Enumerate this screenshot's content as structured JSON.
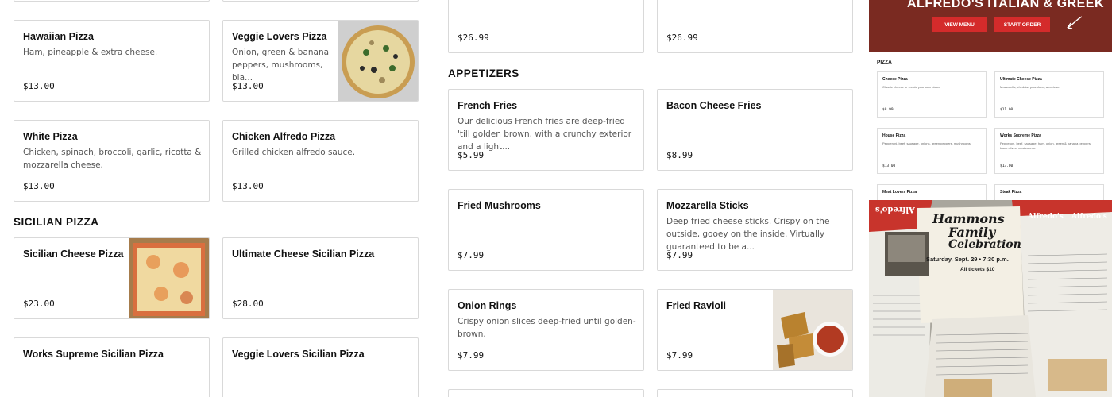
{
  "left_column": {
    "items": [
      {
        "name": "Hawaiian Pizza",
        "desc": "Ham, pineapple & extra cheese.",
        "price": "$13.00"
      },
      {
        "name": "Veggie Lovers Pizza",
        "desc": "Onion, green & banana peppers, mushrooms, bla...",
        "price": "$13.00"
      },
      {
        "name": "White Pizza",
        "desc": "Chicken, spinach, broccoli, garlic, ricotta & mozzarella cheese.",
        "price": "$13.00"
      },
      {
        "name": "Chicken Alfredo Pizza",
        "desc": "Grilled chicken alfredo sauce.",
        "price": "$13.00"
      }
    ],
    "sicilian_title": "SICILIAN PIZZA",
    "sicilian_items": [
      {
        "name": "Sicilian Cheese Pizza",
        "price": "$23.00"
      },
      {
        "name": "Ultimate Cheese Sicilian Pizza",
        "price": "$28.00"
      },
      {
        "name": "Works Supreme Sicilian Pizza",
        "price": ""
      },
      {
        "name": "Veggie Lovers Sicilian Pizza",
        "price": ""
      }
    ]
  },
  "middle_column": {
    "top_prices": [
      "$26.99",
      "$26.99"
    ],
    "appetizers_title": "APPETIZERS",
    "appetizers": [
      {
        "name": "French Fries",
        "desc": "Our delicious French fries are deep-fried 'till golden brown, with a crunchy exterior and a light...",
        "price": "$5.99"
      },
      {
        "name": "Bacon Cheese Fries",
        "desc": "",
        "price": "$8.99"
      },
      {
        "name": "Fried Mushrooms",
        "desc": "",
        "price": "$7.99"
      },
      {
        "name": "Mozzarella Sticks",
        "desc": "Deep fried cheese sticks. Crispy on the outside, gooey on the inside. Virtually guaranteed to be a...",
        "price": "$7.99"
      },
      {
        "name": "Onion Rings",
        "desc": "Crispy onion slices deep-fried until golden-brown.",
        "price": "$7.99"
      },
      {
        "name": "Fried Ravioli",
        "desc": "",
        "price": "$7.99"
      }
    ]
  },
  "preview": {
    "hero_title": "ALFREDO'S ITALIAN & GREEK",
    "view_menu": "VIEW MENU",
    "start_order": "START ORDER",
    "section": "PIZZA",
    "cards": [
      {
        "name": "Cheese Pizza",
        "desc": "Classic cheese or create your own pizza.",
        "price": "$8.99"
      },
      {
        "name": "Ultimate Cheese Pizza",
        "desc": "Mozzarella, cheddar, provolone, american.",
        "price": "$11.00"
      },
      {
        "name": "House Pizza",
        "desc": "Pepperoni, beef, sausage, onions, green peppers, mushrooms.",
        "price": "$13.00"
      },
      {
        "name": "Works Supreme Pizza",
        "desc": "Pepperoni, beef, sausage, ham, onion, green & banana peppers, black olives, mushrooms.",
        "price": "$13.00"
      },
      {
        "name": "Meat Lovers Pizza",
        "desc": "",
        "price": ""
      },
      {
        "name": "Steak Pizza",
        "desc": "",
        "price": ""
      }
    ],
    "photo": {
      "flyer_title_1": "Hammons",
      "flyer_title_2": "Family",
      "flyer_sub": "Celebration",
      "flyer_date": "Saturday, Sept. 29 • 7:30 p.m.",
      "flyer_tickets": "All tickets $10",
      "brand": "Alfredo's"
    }
  },
  "colors": {
    "accent_red": "#d42b2b",
    "hero_bg": "#7a2a21",
    "card_border": "#d9d9d9"
  }
}
